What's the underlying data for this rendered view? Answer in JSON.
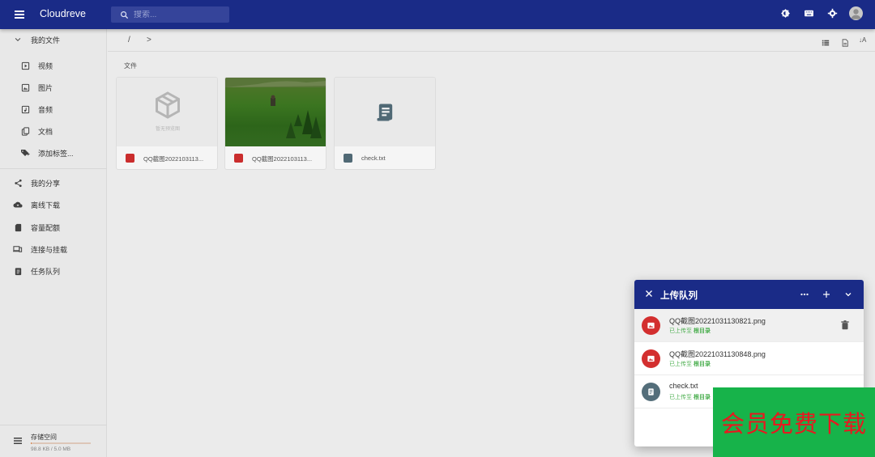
{
  "app": {
    "title": "Cloudreve"
  },
  "search": {
    "placeholder": "搜索..."
  },
  "sidebar": {
    "my_files": "我的文件",
    "sub_items": [
      {
        "label": "视频",
        "icon": "video-icon"
      },
      {
        "label": "图片",
        "icon": "image-icon"
      },
      {
        "label": "音频",
        "icon": "audio-icon"
      },
      {
        "label": "文档",
        "icon": "document-icon"
      },
      {
        "label": "添加标签...",
        "icon": "tag-add-icon"
      }
    ],
    "items": [
      {
        "label": "我的分享",
        "icon": "share-icon"
      },
      {
        "label": "离线下载",
        "icon": "cloud-download-icon"
      },
      {
        "label": "容量配额",
        "icon": "sd-card-icon"
      },
      {
        "label": "连接与挂载",
        "icon": "devices-icon"
      },
      {
        "label": "任务队列",
        "icon": "clipboard-icon"
      }
    ],
    "storage": {
      "label": "存储空间",
      "usage": "98.8 KB / 5.0 MB",
      "used_fraction": 0.019
    }
  },
  "toolbar": {
    "path_root": "/",
    "path_arrow": ">"
  },
  "main": {
    "section_label": "文件",
    "files": [
      {
        "name": "QQ截图2022103113...",
        "type": "image",
        "thumb_caption": "暂无预览图"
      },
      {
        "name": "QQ截图2022103113...",
        "type": "image"
      },
      {
        "name": "check.txt",
        "type": "text"
      }
    ]
  },
  "queue": {
    "title": "上传队列",
    "items": [
      {
        "name": "QQ截图20221031130821.png",
        "status": "已上传至",
        "target": "根目录",
        "type": "image"
      },
      {
        "name": "QQ截图20221031130848.png",
        "status": "已上传至",
        "target": "根目录",
        "type": "image"
      },
      {
        "name": "check.txt",
        "status": "已上传至",
        "target": "根目录",
        "type": "text"
      }
    ]
  },
  "ad": {
    "text": "会员免费下载"
  },
  "colors": {
    "primary": "#1a2b87",
    "image_icon": "#d32f2f",
    "text_icon": "#546e7a",
    "success": "#4caf50",
    "ad_bg": "#17b34a",
    "ad_text": "#e8181f"
  }
}
